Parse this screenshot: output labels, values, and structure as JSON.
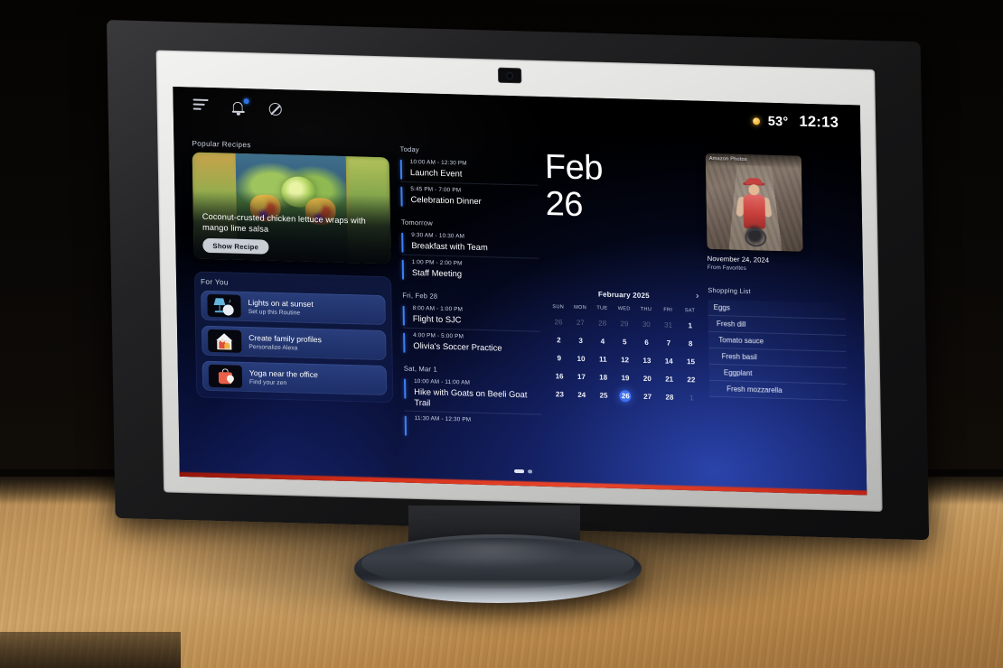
{
  "topbar": {
    "menu_icon": "hamburger-lines-icon",
    "bell_icon": "notification-bell-icon",
    "dnd_icon": "do-not-disturb-icon",
    "weather_icon": "sun-icon",
    "temperature": "53°",
    "time": "12:13"
  },
  "recipes": {
    "section_label": "Popular Recipes",
    "title": "Coconut-crusted chicken lettuce wraps with mango lime salsa",
    "button_label": "Show Recipe"
  },
  "for_you": {
    "section_label": "For You",
    "items": [
      {
        "title": "Lights on at sunset",
        "subtitle": "Set up this Routine",
        "icon": "lamp-music-icon"
      },
      {
        "title": "Create family profiles",
        "subtitle": "Personalize Alexa",
        "icon": "family-house-icon"
      },
      {
        "title": "Yoga near the office",
        "subtitle": "Find your zen",
        "icon": "shopping-bag-pin-icon"
      }
    ]
  },
  "agenda": {
    "groups": [
      {
        "day": "Today",
        "events": [
          {
            "time": "10:00 AM - 12:30 PM",
            "name": "Launch Event"
          },
          {
            "time": "5:45 PM - 7:00 PM",
            "name": "Celebration Dinner"
          }
        ]
      },
      {
        "day": "Tomorrow",
        "events": [
          {
            "time": "9:30 AM - 10:30 AM",
            "name": "Breakfast with Team"
          },
          {
            "time": "1:00 PM - 2:00 PM",
            "name": "Staff Meeting"
          }
        ]
      },
      {
        "day": "Fri, Feb 28",
        "events": [
          {
            "time": "8:00 AM - 1:00 PM",
            "name": "Flight to SJC"
          },
          {
            "time": "4:00 PM - 5:00 PM",
            "name": "Olivia's Soccer Practice"
          }
        ]
      },
      {
        "day": "Sat, Mar 1",
        "events": [
          {
            "time": "10:00 AM - 11:00 AM",
            "name": "Hike with Goats on Beeli Goat Trail"
          },
          {
            "time": "11:30 AM - 12:30 PM",
            "name": ""
          }
        ]
      }
    ]
  },
  "date_panel": {
    "month_short": "Feb",
    "day_number": "26"
  },
  "calendar": {
    "title": "February 2025",
    "next_icon": "chevron-right-icon",
    "dow": [
      "SUN",
      "MON",
      "TUE",
      "WED",
      "THU",
      "FRI",
      "SAT"
    ],
    "weeks": [
      [
        {
          "n": "26",
          "muted": true
        },
        {
          "n": "27",
          "muted": true
        },
        {
          "n": "28",
          "muted": true
        },
        {
          "n": "29",
          "muted": true
        },
        {
          "n": "30",
          "muted": true
        },
        {
          "n": "31",
          "muted": true
        },
        {
          "n": "1",
          "muted": false
        }
      ],
      [
        {
          "n": "2"
        },
        {
          "n": "3"
        },
        {
          "n": "4"
        },
        {
          "n": "5"
        },
        {
          "n": "6"
        },
        {
          "n": "7"
        },
        {
          "n": "8"
        }
      ],
      [
        {
          "n": "9"
        },
        {
          "n": "10"
        },
        {
          "n": "11"
        },
        {
          "n": "12"
        },
        {
          "n": "13"
        },
        {
          "n": "14"
        },
        {
          "n": "15"
        }
      ],
      [
        {
          "n": "16"
        },
        {
          "n": "17"
        },
        {
          "n": "18"
        },
        {
          "n": "19"
        },
        {
          "n": "20"
        },
        {
          "n": "21"
        },
        {
          "n": "22"
        }
      ],
      [
        {
          "n": "23"
        },
        {
          "n": "24"
        },
        {
          "n": "25"
        },
        {
          "n": "26",
          "today": true
        },
        {
          "n": "27"
        },
        {
          "n": "28"
        },
        {
          "n": "1",
          "muted": true
        }
      ]
    ]
  },
  "photo": {
    "overlay_label": "Amazon Photos",
    "date": "November 24, 2024",
    "source": "From Favorites"
  },
  "shopping": {
    "label": "Shopping List",
    "items": [
      "Eggs",
      "Fresh dill",
      "Tomato sauce",
      "Fresh basil",
      "Eggplant",
      "Fresh mozzarella"
    ]
  },
  "pagination": {
    "active_index": 0,
    "count": 2
  },
  "colors": {
    "accent_blue": "#3f7ff2",
    "today_blue": "#3f6ff0",
    "red_strip": "#d6301a",
    "screen_base": "#060a26"
  }
}
